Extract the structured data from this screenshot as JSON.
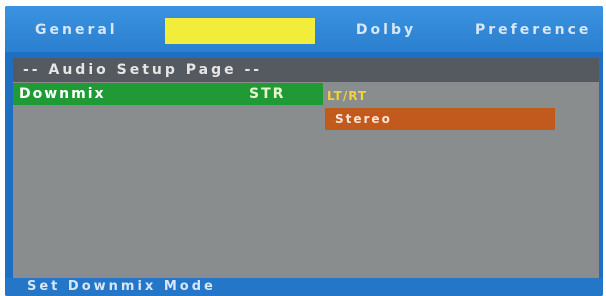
{
  "tabs": {
    "general": "General",
    "dolby": "Dolby",
    "preference": "Preference"
  },
  "page_title": "-- Audio Setup Page --",
  "downmix": {
    "label": "Downmix",
    "value": "STR"
  },
  "options": {
    "ltrt": "LT/RT",
    "stereo": "Stereo"
  },
  "status": "Set Downmix Mode",
  "colors": {
    "tab_bar": "#2b7fd0",
    "active_tab": "#f2ec3a",
    "selected_row": "#1f9a35",
    "highlighted_option": "#c25a1e",
    "content_bg": "#8a8d8e"
  }
}
